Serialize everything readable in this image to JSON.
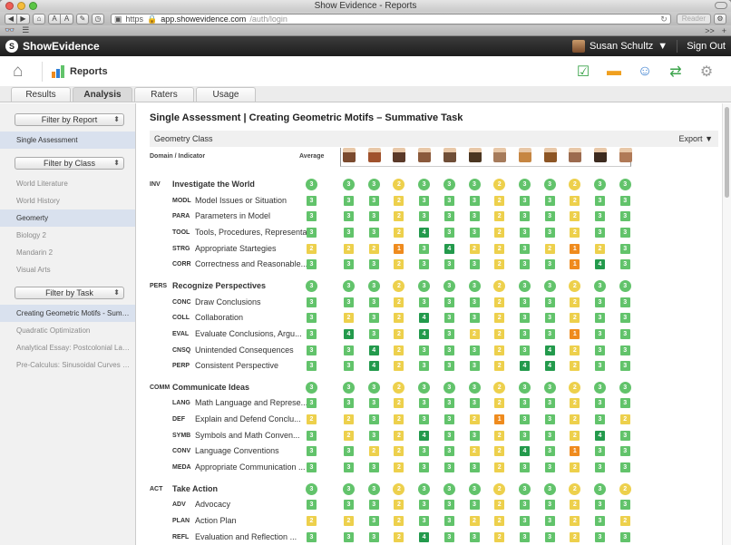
{
  "window": {
    "title": "Show Evidence - Reports"
  },
  "browser": {
    "url_scheme": "https",
    "url_host": "app.showevidence.com",
    "url_path": "/auth/login",
    "reader_label": "Reader",
    "bookmarks_more": ">>"
  },
  "app": {
    "brand": "ShowEvidence",
    "user_name": "Susan Schultz",
    "user_caret": "▼",
    "sign_out": "Sign Out",
    "section_title": "Reports"
  },
  "tabs": [
    "Results",
    "Analysis",
    "Raters",
    "Usage"
  ],
  "active_tab": "Analysis",
  "sidebar": {
    "filter_report": "Filter by Report",
    "reports": [
      "Single Assessment"
    ],
    "filter_class": "Filter by Class",
    "classes": [
      "World Literature",
      "World History",
      "Geomerty",
      "Biology 2",
      "Mandarin 2",
      "Visual Arts"
    ],
    "filter_task": "Filter by Task",
    "tasks": [
      "Creating Geometric Motifs - Summa...",
      "Quadratic Optimization",
      "Analytical Essay: Postcolonial Latin ...",
      "Pre-Calculus: Sinusoidal Curves and ..."
    ]
  },
  "report": {
    "title": "Single Assessment | Creating Geometric Motifs – Summative Task",
    "class_name": "Geometry Class",
    "export_label": "Export",
    "export_caret": "▼",
    "col_domain": "Domain / Indicator",
    "col_average": "Average"
  },
  "colors": {
    "1": "#ef8b1e",
    "2": "#edd04c",
    "3": "#62c36b",
    "4": "#239a4c"
  },
  "student_avatar_colors": [
    "#7b4a2e",
    "#a0522d",
    "#5b3a29",
    "#8b5a3c",
    "#6f4e37",
    "#4b3621",
    "#a67b5b",
    "#c68642",
    "#8d5524",
    "#9c6b4f",
    "#3d2b1f",
    "#b07a57"
  ],
  "rows": [
    {
      "type": "domain",
      "code": "INV",
      "label": "Investigate the World",
      "avg": "3",
      "scores": [
        "3",
        "3",
        "2",
        "3",
        "3",
        "3",
        "2",
        "3",
        "3",
        "2",
        "3",
        "3"
      ]
    },
    {
      "type": "ind",
      "code": "MODL",
      "label": "Model Issues or Situation",
      "avg": "3",
      "scores": [
        "3",
        "3",
        "2",
        "3",
        "3",
        "3",
        "2",
        "3",
        "3",
        "2",
        "3",
        "3"
      ]
    },
    {
      "type": "ind",
      "code": "PARA",
      "label": "Parameters in Model",
      "avg": "3",
      "scores": [
        "3",
        "3",
        "2",
        "3",
        "3",
        "3",
        "2",
        "3",
        "3",
        "2",
        "3",
        "3"
      ]
    },
    {
      "type": "ind",
      "code": "TOOL",
      "label": "Tools, Procedures, Representa...",
      "avg": "3",
      "scores": [
        "3",
        "3",
        "2",
        "4",
        "3",
        "3",
        "2",
        "3",
        "3",
        "2",
        "3",
        "3"
      ]
    },
    {
      "type": "ind",
      "code": "STRG",
      "label": "Appropriate Startegies",
      "avg": "2",
      "scores": [
        "2",
        "2",
        "1",
        "3",
        "4",
        "2",
        "2",
        "3",
        "2",
        "1",
        "2",
        "3"
      ]
    },
    {
      "type": "ind",
      "code": "CORR",
      "label": "Correctness and Reasonable...",
      "avg": "3",
      "scores": [
        "3",
        "3",
        "2",
        "3",
        "3",
        "3",
        "2",
        "3",
        "3",
        "1",
        "4",
        "3"
      ]
    },
    {
      "type": "domain",
      "code": "PERS",
      "label": "Recognize Perspectives",
      "avg": "3",
      "scores": [
        "3",
        "3",
        "2",
        "3",
        "3",
        "3",
        "2",
        "3",
        "3",
        "2",
        "3",
        "3"
      ]
    },
    {
      "type": "ind",
      "code": "CONC",
      "label": "Draw Conclusions",
      "avg": "3",
      "scores": [
        "3",
        "3",
        "2",
        "3",
        "3",
        "3",
        "2",
        "3",
        "3",
        "2",
        "3",
        "3"
      ]
    },
    {
      "type": "ind",
      "code": "COLL",
      "label": "Collaboration",
      "avg": "3",
      "scores": [
        "2",
        "3",
        "2",
        "4",
        "3",
        "3",
        "2",
        "3",
        "3",
        "2",
        "3",
        "3"
      ]
    },
    {
      "type": "ind",
      "code": "EVAL",
      "label": "Evaluate Conclusions, Argu...",
      "avg": "3",
      "scores": [
        "4",
        "3",
        "2",
        "4",
        "3",
        "2",
        "2",
        "3",
        "3",
        "1",
        "3",
        "3"
      ]
    },
    {
      "type": "ind",
      "code": "CNSQ",
      "label": "Unintended Consequences",
      "avg": "3",
      "scores": [
        "3",
        "4",
        "2",
        "3",
        "3",
        "3",
        "2",
        "3",
        "4",
        "2",
        "3",
        "3"
      ]
    },
    {
      "type": "ind",
      "code": "PERP",
      "label": "Consistent Perspective",
      "avg": "3",
      "scores": [
        "3",
        "4",
        "2",
        "3",
        "3",
        "3",
        "2",
        "4",
        "4",
        "2",
        "3",
        "3"
      ]
    },
    {
      "type": "domain",
      "code": "COMM",
      "label": "Communicate Ideas",
      "avg": "3",
      "scores": [
        "3",
        "3",
        "2",
        "3",
        "3",
        "3",
        "2",
        "3",
        "3",
        "2",
        "3",
        "3"
      ]
    },
    {
      "type": "ind",
      "code": "LANG",
      "label": "Math Language and Represe...",
      "avg": "3",
      "scores": [
        "3",
        "3",
        "2",
        "3",
        "3",
        "3",
        "2",
        "3",
        "3",
        "2",
        "3",
        "3"
      ]
    },
    {
      "type": "ind",
      "code": "DEF",
      "label": "Explain and Defend Conclu...",
      "avg": "2",
      "scores": [
        "2",
        "3",
        "2",
        "3",
        "3",
        "2",
        "1",
        "3",
        "3",
        "2",
        "3",
        "2"
      ]
    },
    {
      "type": "ind",
      "code": "SYMB",
      "label": "Symbols and Math Conven...",
      "avg": "3",
      "scores": [
        "2",
        "3",
        "2",
        "4",
        "3",
        "3",
        "2",
        "3",
        "3",
        "2",
        "4",
        "3"
      ]
    },
    {
      "type": "ind",
      "code": "CONV",
      "label": "Language Conventions",
      "avg": "3",
      "scores": [
        "3",
        "2",
        "2",
        "3",
        "3",
        "2",
        "2",
        "4",
        "3",
        "1",
        "3",
        "3"
      ]
    },
    {
      "type": "ind",
      "code": "MEDA",
      "label": "Appropriate Communication ...",
      "avg": "3",
      "scores": [
        "3",
        "3",
        "2",
        "3",
        "3",
        "3",
        "2",
        "3",
        "3",
        "2",
        "3",
        "3"
      ]
    },
    {
      "type": "domain",
      "code": "ACT",
      "label": "Take Action",
      "avg": "3",
      "scores": [
        "3",
        "3",
        "2",
        "3",
        "3",
        "3",
        "2",
        "3",
        "3",
        "2",
        "3",
        "2"
      ]
    },
    {
      "type": "ind",
      "code": "ADV",
      "label": "Advocacy",
      "avg": "3",
      "scores": [
        "3",
        "3",
        "2",
        "3",
        "3",
        "3",
        "2",
        "3",
        "3",
        "2",
        "3",
        "3"
      ]
    },
    {
      "type": "ind",
      "code": "PLAN",
      "label": "Action Plan",
      "avg": "2",
      "scores": [
        "2",
        "3",
        "2",
        "3",
        "3",
        "2",
        "2",
        "3",
        "3",
        "2",
        "3",
        "2"
      ]
    },
    {
      "type": "ind",
      "code": "REFL",
      "label": "Evaluation and Reflection ...",
      "avg": "3",
      "scores": [
        "3",
        "3",
        "2",
        "4",
        "3",
        "3",
        "2",
        "3",
        "3",
        "2",
        "3",
        "3"
      ]
    }
  ]
}
